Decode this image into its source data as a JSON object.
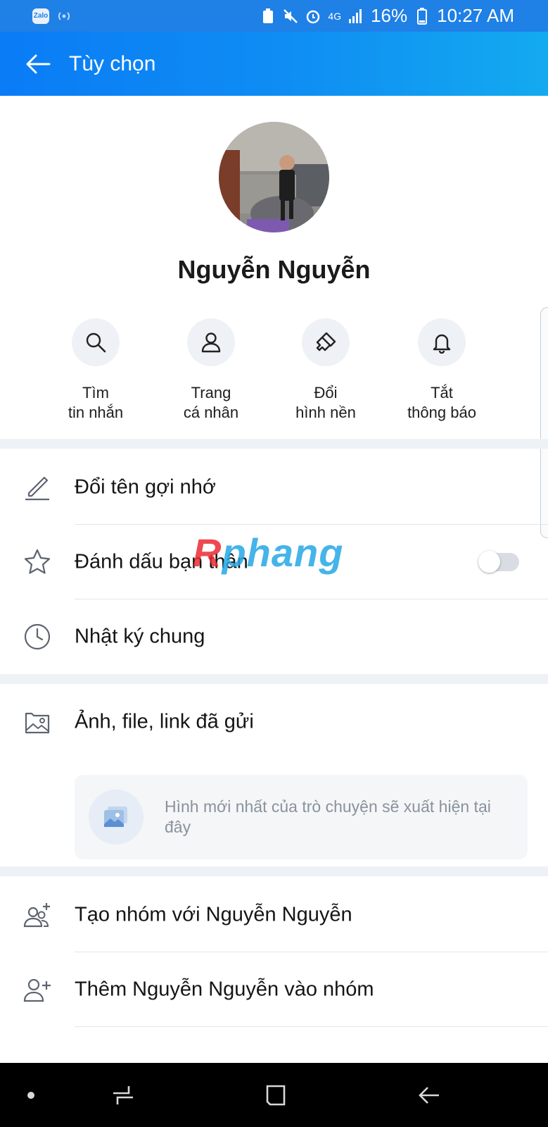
{
  "status_bar": {
    "app_badge": "Zalo",
    "network": "4G",
    "battery": "16%",
    "time": "10:27 AM"
  },
  "app_bar": {
    "title": "Tùy chọn"
  },
  "profile": {
    "name": "Nguyễn Nguyễn"
  },
  "quick_actions": [
    {
      "icon": "search-icon",
      "line1": "Tìm",
      "line2": "tin nhắn"
    },
    {
      "icon": "user-icon",
      "line1": "Trang",
      "line2": "cá nhân"
    },
    {
      "icon": "brush-icon",
      "line1": "Đổi",
      "line2": "hình nền"
    },
    {
      "icon": "bell-icon",
      "line1": "Tắt",
      "line2": "thông báo"
    }
  ],
  "menu": {
    "rename": "Đổi tên gợi nhớ",
    "best_friend": "Đánh dấu bạn thân",
    "best_friend_on": false,
    "diary": "Nhật ký chung",
    "media": "Ảnh, file, link đã gửi",
    "media_empty": "Hình mới nhất của trò chuyện sẽ xuất hiện tại đây",
    "create_group": "Tạo nhóm với Nguyễn Nguyễn",
    "add_to_group": "Thêm Nguyễn Nguyễn vào nhóm"
  },
  "watermark": {
    "part1": "R",
    "part2": "phang"
  },
  "colors": {
    "accent": "#0f8ef3",
    "status_bar": "#1f80e6"
  }
}
